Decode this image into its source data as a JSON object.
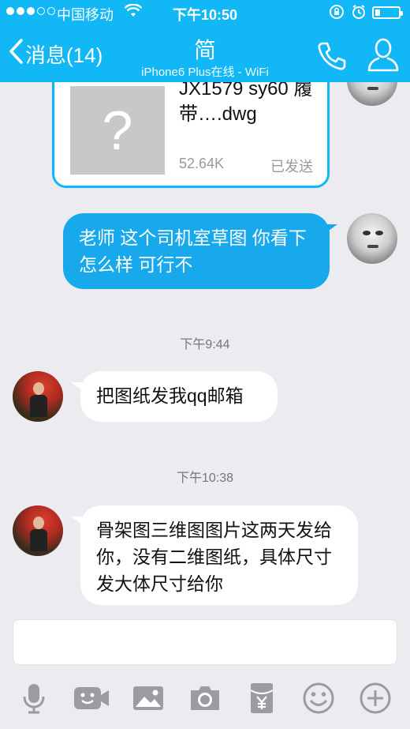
{
  "status_bar": {
    "carrier": "中国移动",
    "time": "下午10:50"
  },
  "header": {
    "back_label": "消息(14)",
    "title": "简",
    "subtitle": "iPhone6 Plus在线 - WiFi"
  },
  "file_message": {
    "name": "JX1579 sy60 履带….dwg",
    "size": "52.64K",
    "status": "已发送"
  },
  "messages": [
    {
      "text": "老师 这个司机室草图 你看下 怎么样 可行不"
    },
    {
      "time": "下午9:44",
      "text": "把图纸发我qq邮箱"
    },
    {
      "time": "下午10:38",
      "text": "骨架图三维图图片这两天发给你，没有二维图纸，具体尺寸发大体尺寸给你"
    }
  ],
  "colors": {
    "accent": "#12b7f5",
    "bubble_me": "#18a9ec",
    "background": "#ebebf0",
    "icon_gray": "#9a9ba3"
  },
  "toolbar_icons": [
    "microphone-icon",
    "video-call-icon",
    "image-icon",
    "camera-icon",
    "red-packet-icon",
    "emoji-icon",
    "add-icon"
  ]
}
